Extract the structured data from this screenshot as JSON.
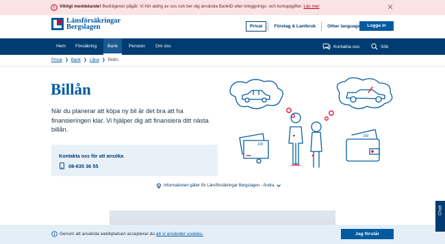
{
  "alert": {
    "title": "Viktigt meddelande!",
    "text": " Bedrägerier pågår. Vi hör aldrig av oss och ber dig använda BankID eller inloggnings- och kortuppgifter.",
    "link": "Läs mer"
  },
  "brand": {
    "line1": "Länsförsäkringar",
    "line2": "Bergslagen"
  },
  "segments": {
    "private": "Privat",
    "business": "Företag & Lantbruk",
    "languages": "Other languages"
  },
  "login_label": "Logga in",
  "nav": {
    "items": [
      "Hem",
      "Försäkring",
      "Bank",
      "Pension",
      "Om oss"
    ],
    "contact": "Kontakta oss",
    "search": "Sök"
  },
  "breadcrumb": [
    "Privat",
    "Bank",
    "Låna",
    "Billån"
  ],
  "page": {
    "title": "Billån",
    "intro": "När du planerar att köpa ny bil är det bra att ha finansieringen klar. Vi hjälper dig att finansiera ditt nästa billån."
  },
  "contact_box": {
    "heading": "Kontakta oss för att ansöka",
    "phone": "08-635 36 55"
  },
  "info_line": "Informationen gäller för Länsförsäkringar Bergslagen - Ändra",
  "cookie": {
    "text": "Genom att använda webbplatsen accepterar du ",
    "link": "att vi använder cookies.",
    "accept": "Jag förstår"
  },
  "chat_label": "Chatt",
  "colors": {
    "brand": "#005AA0",
    "navy": "#003C71",
    "accent_red": "#E4002B",
    "alert_bg": "#FBE3E3",
    "cookie_bg": "#E3EEF7"
  }
}
